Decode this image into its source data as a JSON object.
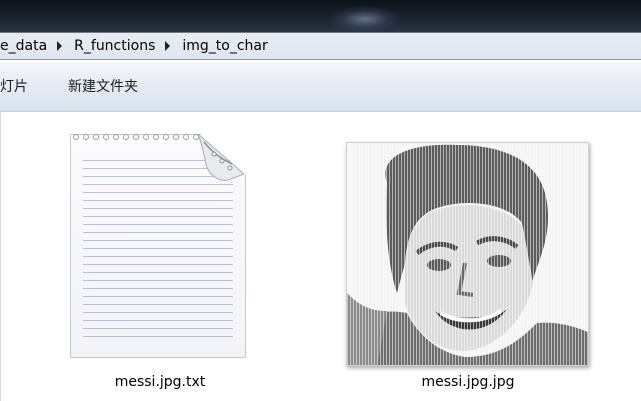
{
  "window": {
    "breadcrumb": [
      "e_data",
      "R_functions",
      "img_to_char"
    ]
  },
  "toolbar": {
    "items": [
      "灯片",
      "新建文件夹"
    ]
  },
  "files": [
    {
      "name": "messi.jpg.txt",
      "icon": "text-document-icon"
    },
    {
      "name": "messi.jpg.jpg",
      "icon": "ascii-art-image-thumbnail"
    }
  ],
  "colors": {
    "titlebar": "#1b2430",
    "addressbar": "#e3e9f0",
    "toolbar": "#e3eaf3",
    "doc_lines": "#b8bfe6"
  }
}
